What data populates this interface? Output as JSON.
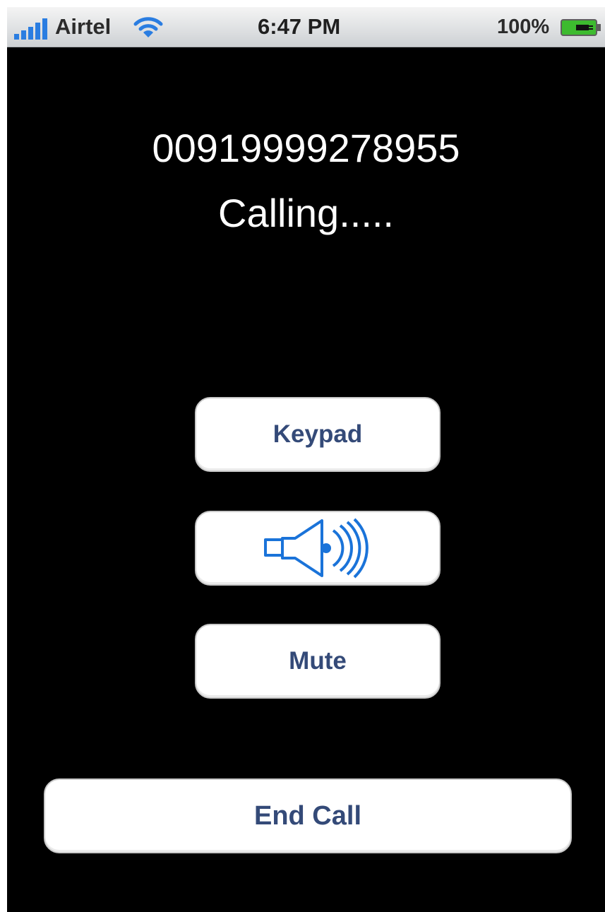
{
  "status_bar": {
    "carrier": "Airtel",
    "time": "6:47 PM",
    "battery_percent": "100%",
    "signal_icon": "signal-bars-icon",
    "wifi_icon": "wifi-icon",
    "battery_icon": "battery-charging-icon"
  },
  "call": {
    "number": "00919999278955",
    "status": "Calling....."
  },
  "buttons": {
    "keypad_label": "Keypad",
    "speaker_icon": "speaker-icon",
    "mute_label": "Mute",
    "end_call_label": "End Call"
  },
  "colors": {
    "background": "#000000",
    "button_background": "#ffffff",
    "button_text": "#344a78",
    "speaker_icon": "#1a73d9",
    "signal_blue": "#2a7de1",
    "battery_green": "#3dbb2f"
  }
}
